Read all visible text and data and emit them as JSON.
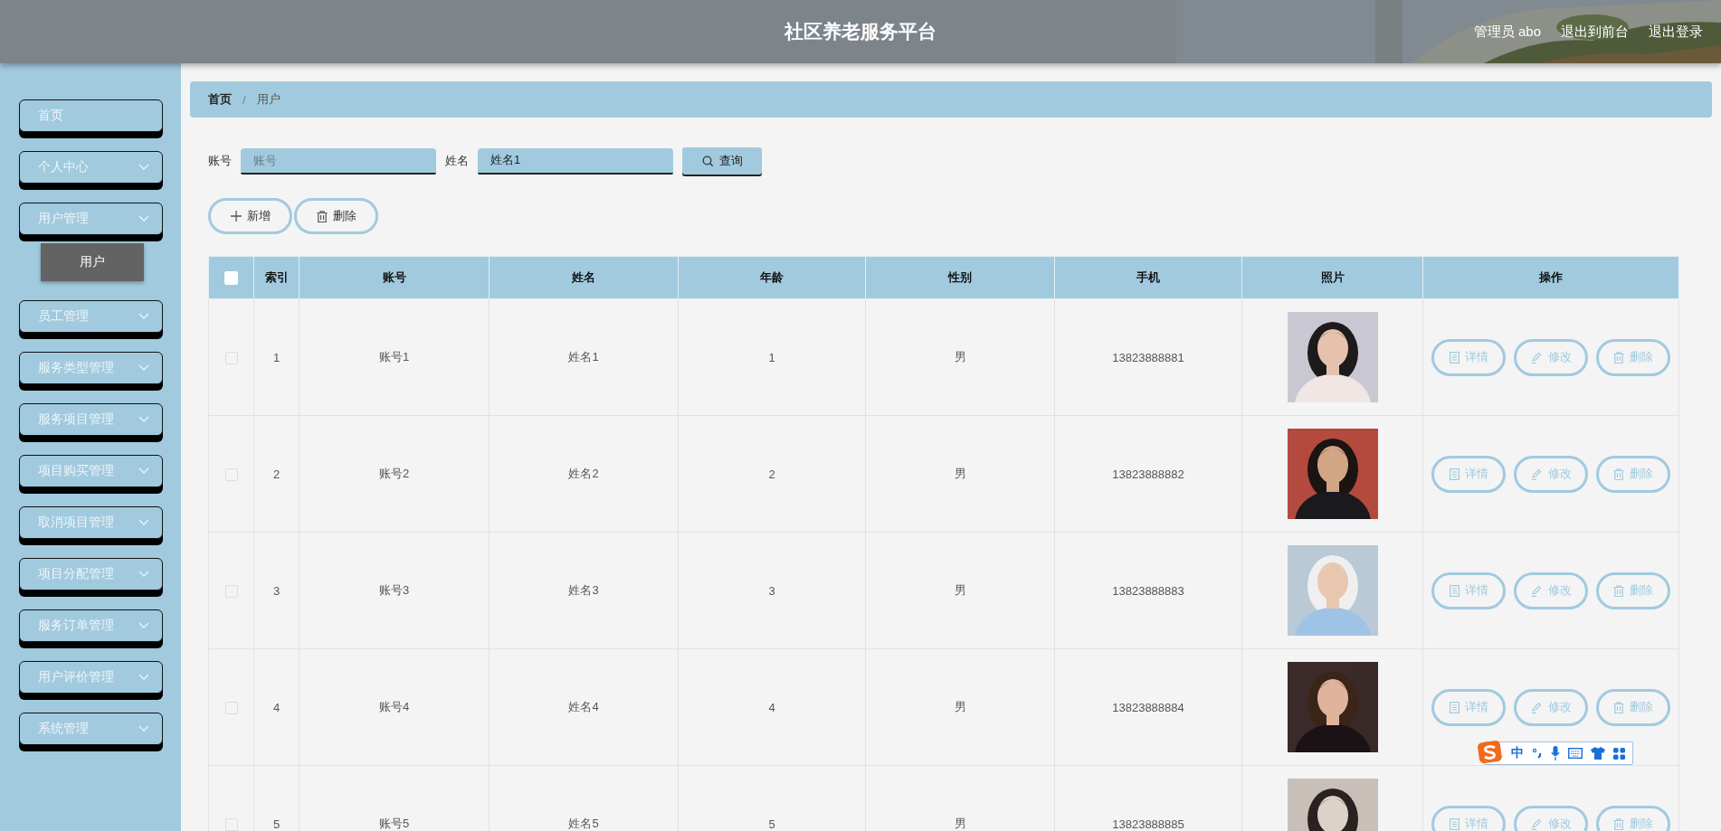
{
  "header": {
    "title": "社区养老服务平台",
    "user": "管理员 abo",
    "links": [
      "退出到前台",
      "退出登录"
    ]
  },
  "sidebar": {
    "items": [
      {
        "label": "首页",
        "expandable": false
      },
      {
        "label": "个人中心",
        "expandable": true
      },
      {
        "label": "用户管理",
        "expandable": true,
        "children": [
          {
            "label": "用户",
            "selected": true
          }
        ]
      },
      {
        "label": "员工管理",
        "expandable": true
      },
      {
        "label": "服务类型管理",
        "expandable": true
      },
      {
        "label": "服务项目管理",
        "expandable": true
      },
      {
        "label": "项目购买管理",
        "expandable": true
      },
      {
        "label": "取消项目管理",
        "expandable": true
      },
      {
        "label": "项目分配管理",
        "expandable": true
      },
      {
        "label": "服务订单管理",
        "expandable": true
      },
      {
        "label": "用户评价管理",
        "expandable": true
      },
      {
        "label": "系统管理",
        "expandable": true
      }
    ]
  },
  "breadcrumb": {
    "items": [
      "首页",
      "用户"
    ],
    "separator": "/"
  },
  "search": {
    "fields": [
      {
        "label": "账号",
        "placeholder": "账号"
      },
      {
        "label": "姓名",
        "value": "姓名1"
      }
    ],
    "button": "查询"
  },
  "actions": [
    {
      "kind": "add",
      "label": "新增"
    },
    {
      "kind": "delete",
      "label": "删除"
    }
  ],
  "table": {
    "select_all_checked": false,
    "columns": [
      "索引",
      "账号",
      "姓名",
      "年龄",
      "性别",
      "手机",
      "照片",
      "操作"
    ],
    "rows": [
      {
        "checked": false,
        "index": "1",
        "account": "账号1",
        "name": "姓名1",
        "age": "1",
        "gender": "男",
        "phone": "13823888881",
        "actions": [
          {
            "kind": "detail",
            "label": "详情"
          },
          {
            "kind": "edit",
            "label": "修改"
          },
          {
            "kind": "delete",
            "label": "删除"
          }
        ]
      },
      {
        "checked": false,
        "index": "2",
        "account": "账号2",
        "name": "姓名2",
        "age": "2",
        "gender": "男",
        "phone": "13823888882",
        "actions": [
          {
            "kind": "detail",
            "label": "详情"
          },
          {
            "kind": "edit",
            "label": "修改"
          },
          {
            "kind": "delete",
            "label": "删除"
          }
        ]
      },
      {
        "checked": false,
        "index": "3",
        "account": "账号3",
        "name": "姓名3",
        "age": "3",
        "gender": "男",
        "phone": "13823888883",
        "actions": [
          {
            "kind": "detail",
            "label": "详情"
          },
          {
            "kind": "edit",
            "label": "修改"
          },
          {
            "kind": "delete",
            "label": "删除"
          }
        ]
      },
      {
        "checked": false,
        "index": "4",
        "account": "账号4",
        "name": "姓名4",
        "age": "4",
        "gender": "男",
        "phone": "13823888884",
        "actions": [
          {
            "kind": "detail",
            "label": "详情"
          },
          {
            "kind": "edit",
            "label": "修改"
          },
          {
            "kind": "delete",
            "label": "删除"
          }
        ]
      },
      {
        "checked": false,
        "index": "5",
        "account": "账号5",
        "name": "姓名5",
        "age": "5",
        "gender": "男",
        "phone": "13823888885",
        "actions": [
          {
            "kind": "detail",
            "label": "详情"
          },
          {
            "kind": "edit",
            "label": "修改"
          },
          {
            "kind": "delete",
            "label": "删除"
          }
        ]
      }
    ]
  },
  "ime_toolbar": {
    "mode": "中"
  }
}
